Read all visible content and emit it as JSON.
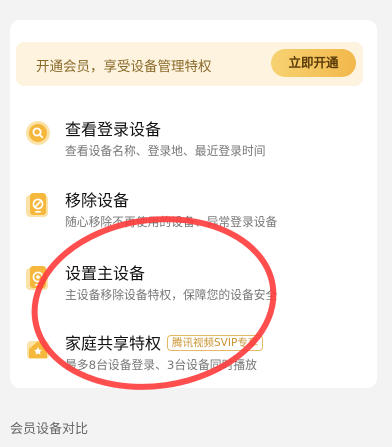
{
  "promo": {
    "text": "开通会员，享受设备管理特权",
    "button_label": "立即开通"
  },
  "features": [
    {
      "title": "查看登录设备",
      "desc": "查看设备名称、登录地、最近登录时间",
      "icon": "search-icon"
    },
    {
      "title": "移除设备",
      "desc": "随心移除不再使用的设备、异常登录设备",
      "icon": "remove-device-icon"
    },
    {
      "title": "设置主设备",
      "desc": "主设备移除设备特权，保障您的设备安全",
      "icon": "main-device-icon"
    },
    {
      "title": "家庭共享特权",
      "badge": "腾讯视频SVIP专享",
      "desc": "最多8台设备登录、3台设备同时播放",
      "icon": "family-share-icon"
    }
  ],
  "section_label": "会员设备对比",
  "colors": {
    "accent": "#f2b84b",
    "promo_bg": "#fdf3df",
    "annotation": "#ff3b3b"
  }
}
